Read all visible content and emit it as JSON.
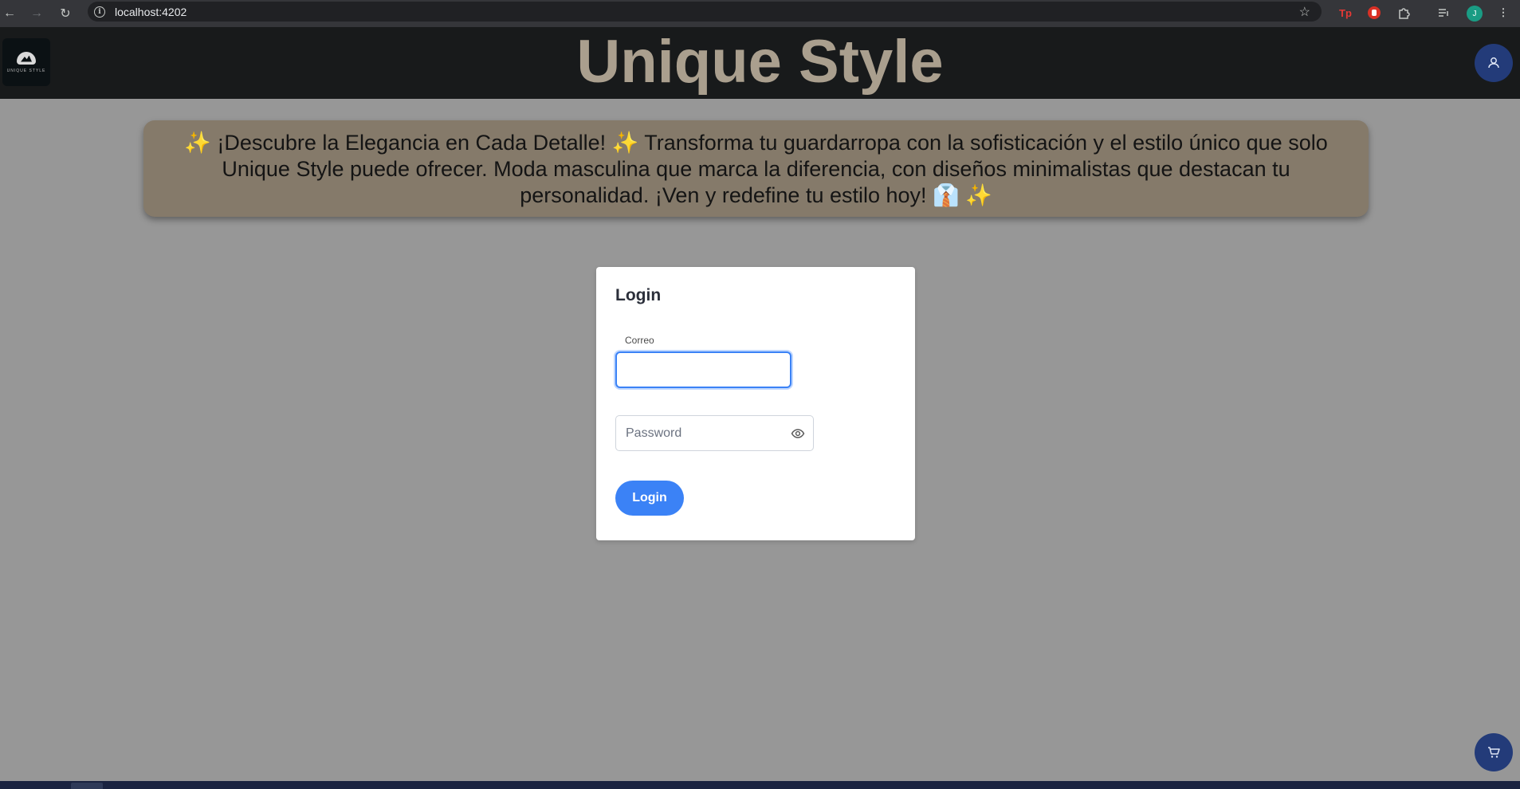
{
  "browser": {
    "url": "localhost:4202",
    "profile_initial": "J",
    "ext_tp_label": "Tp"
  },
  "header": {
    "title": "Unique Style",
    "logo_text": "UNIQUE STYLE"
  },
  "banner": {
    "text": "✨ ¡Descubre la Elegancia en Cada Detalle! ✨ Transforma tu guardarropa con la sofisticación y el estilo único que solo Unique Style puede ofrecer. Moda masculina que marca la diferencia, con diseños minimalistas que destacan tu personalidad. ¡Ven y redefine tu estilo hoy! 👔 ✨"
  },
  "login": {
    "title": "Login",
    "email_label": "Correo",
    "email_value": "",
    "password_placeholder": "Password",
    "submit_label": "Login"
  },
  "colors": {
    "accent": "#3b82f6",
    "header_bg": "#181a1b",
    "title_color": "#aa9f8e",
    "banner_bg": "#857a6a",
    "fab_bg": "#233b79"
  }
}
